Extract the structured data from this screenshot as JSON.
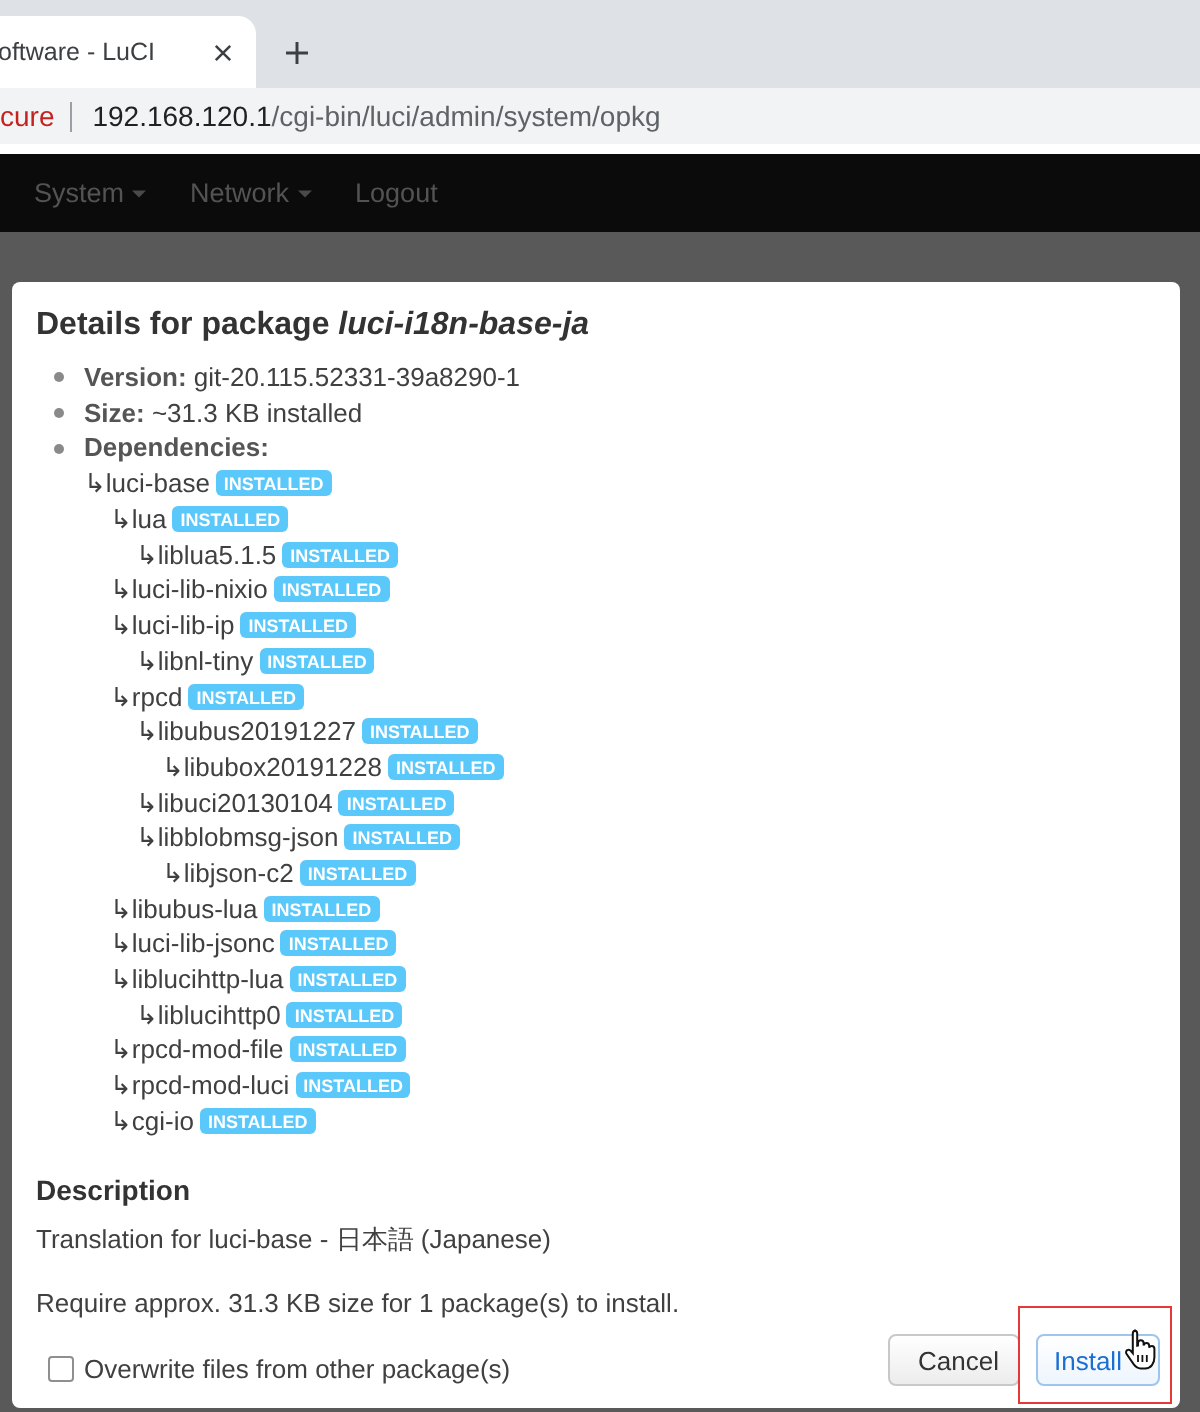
{
  "browser": {
    "tab": {
      "title": "oftware - LuCI"
    },
    "address": {
      "security": "cure",
      "host": "192.168.120.1",
      "path": "/cgi-bin/luci/admin/system/opkg"
    }
  },
  "nav": {
    "items": [
      {
        "label": "System",
        "dropdown": true
      },
      {
        "label": "Network",
        "dropdown": true
      },
      {
        "label": "Logout",
        "dropdown": false
      }
    ]
  },
  "dialog": {
    "title": "Details for package *luci-i18n-base-ja*",
    "details": [
      "**Version:** git-20.115.52331-39a8290-1",
      "**Size:** ~31.3 KB installed",
      "**Dependencies:**"
    ],
    "dependencies": [
      {
        "name": "↳luci-base",
        "status": "INSTALLED",
        "children": [
          {
            "name": "↳lua",
            "status": "INSTALLED",
            "children": [
              {
                "name": "↳liblua5.1.5",
                "status": "INSTALLED"
              }
            ]
          },
          {
            "name": "↳luci-lib-nixio",
            "status": "INSTALLED"
          },
          {
            "name": "↳luci-lib-ip",
            "status": "INSTALLED",
            "children": [
              {
                "name": "↳libnl-tiny",
                "status": "INSTALLED"
              }
            ]
          },
          {
            "name": "↳rpcd",
            "status": "INSTALLED",
            "children": [
              {
                "name": "↳libubus20191227",
                "status": "INSTALLED",
                "children": [
                  {
                    "name": "↳libubox20191228",
                    "status": "INSTALLED"
                  }
                ]
              },
              {
                "name": "↳libuci20130104",
                "status": "INSTALLED"
              },
              {
                "name": "↳libblobmsg-json",
                "status": "INSTALLED",
                "children": [
                  {
                    "name": "↳libjson-c2",
                    "status": "INSTALLED"
                  }
                ]
              }
            ]
          },
          {
            "name": "↳libubus-lua",
            "status": "INSTALLED"
          },
          {
            "name": "↳luci-lib-jsonc",
            "status": "INSTALLED"
          },
          {
            "name": "↳liblucihttp-lua",
            "status": "INSTALLED",
            "children": [
              {
                "name": "↳liblucihttp0",
                "status": "INSTALLED"
              }
            ]
          },
          {
            "name": "↳rpcd-mod-file",
            "status": "INSTALLED"
          },
          {
            "name": "↳rpcd-mod-luci",
            "status": "INSTALLED"
          },
          {
            "name": "↳cgi-io",
            "status": "INSTALLED"
          }
        ]
      }
    ],
    "description": {
      "heading": "Description",
      "text": "Translation for luci-base - 日本語 (Japanese)"
    },
    "summary": "Require approx. 31.3 KB size for 1 package(s) to install.",
    "overwrite": {
      "label": "Overwrite files from other package(s)",
      "checked": false
    },
    "buttons": [
      {
        "label": "Cancel",
        "kind": "default",
        "highlighted": false,
        "hovered": false
      },
      {
        "label": "Install",
        "kind": "primary",
        "highlighted": true,
        "hovered": true
      }
    ]
  }
}
